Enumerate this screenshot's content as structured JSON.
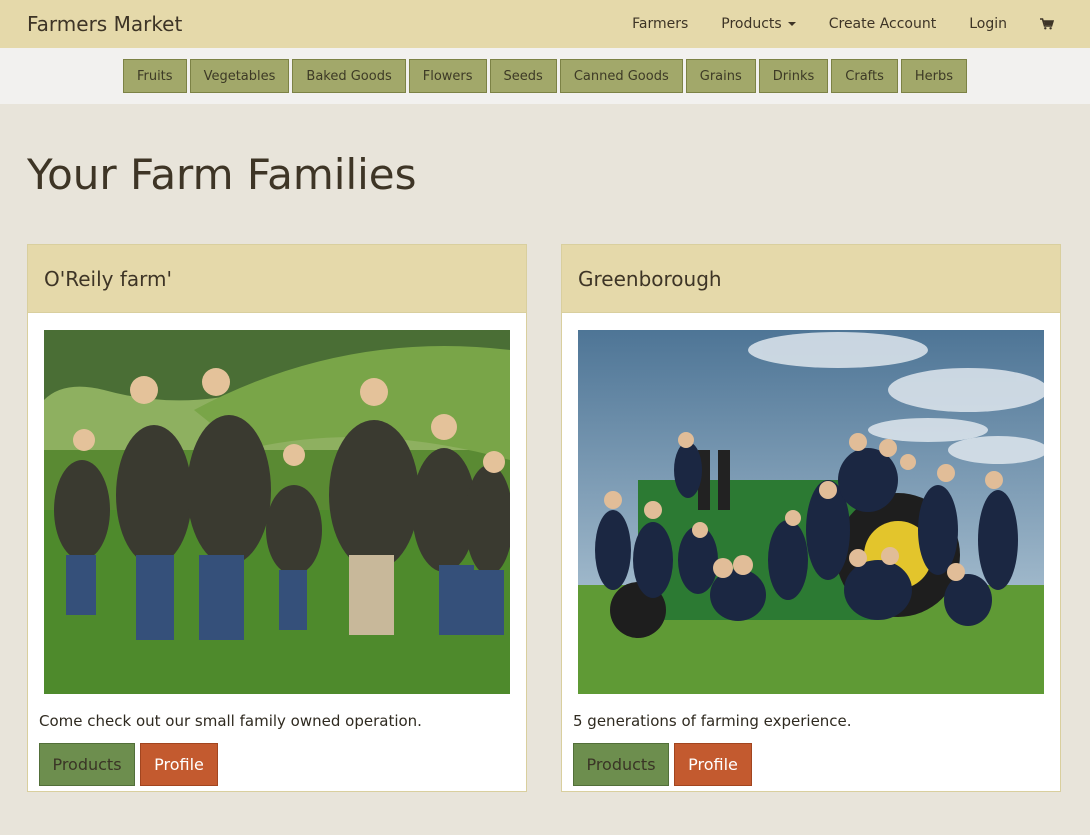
{
  "navbar": {
    "brand": "Farmers Market",
    "links": [
      "Farmers",
      "Products",
      "Create Account",
      "Login"
    ],
    "cart_icon": "cart-icon"
  },
  "categories": [
    "Fruits",
    "Vegetables",
    "Baked Goods",
    "Flowers",
    "Seeds",
    "Canned Goods",
    "Grains",
    "Drinks",
    "Crafts",
    "Herbs"
  ],
  "page": {
    "title": "Your Farm Families"
  },
  "farms": [
    {
      "name": "O'Reily farm'",
      "description": "Come check out our small family owned operation.",
      "products_label": "Products",
      "profile_label": "Profile"
    },
    {
      "name": "Greenborough",
      "description": "5 generations of farming experience.",
      "products_label": "Products",
      "profile_label": "Profile"
    }
  ],
  "colors": {
    "navbar": "#e5d9aa",
    "category_button": "#a2a86a",
    "products_button": "#6d8e4e",
    "profile_button": "#c35a2f"
  }
}
